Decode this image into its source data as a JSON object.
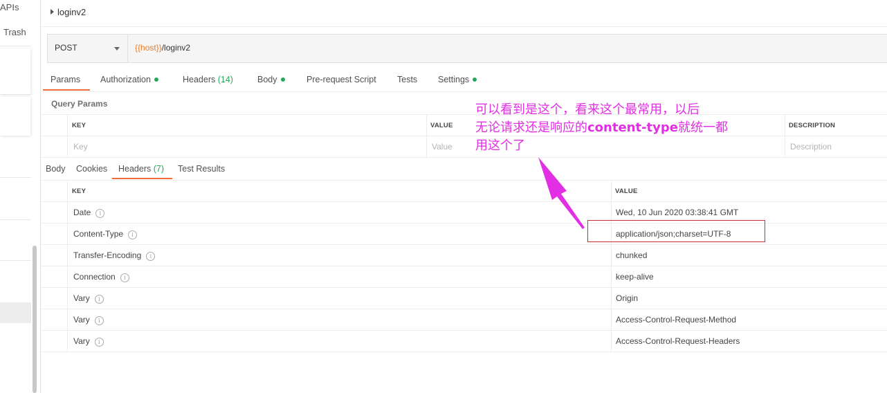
{
  "sidebar": {
    "tab_apis": "APIs",
    "tab_trash": "Trash"
  },
  "request": {
    "name": "loginv2",
    "method": "POST",
    "url_variable": "{{host}}",
    "url_path": "/loginv2"
  },
  "request_tabs": [
    {
      "label": "Params"
    },
    {
      "label": "Authorization"
    },
    {
      "label": "Headers",
      "count": "(14)"
    },
    {
      "label": "Body"
    },
    {
      "label": "Pre-request Script"
    },
    {
      "label": "Tests"
    },
    {
      "label": "Settings"
    }
  ],
  "query_params": {
    "title": "Query Params",
    "col_key": "KEY",
    "col_value": "VALUE",
    "col_description": "DESCRIPTION",
    "key_placeholder": "Key",
    "value_placeholder": "Value",
    "description_placeholder": "Description"
  },
  "response_tabs": [
    {
      "label": "Body"
    },
    {
      "label": "Cookies"
    },
    {
      "label": "Headers",
      "count": "(7)"
    },
    {
      "label": "Test Results"
    }
  ],
  "response_headers": {
    "col_key": "KEY",
    "col_value": "VALUE",
    "rows": [
      {
        "key": "Date",
        "value": "Wed, 10 Jun 2020 03:38:41 GMT"
      },
      {
        "key": "Content-Type",
        "value": "application/json;charset=UTF-8"
      },
      {
        "key": "Transfer-Encoding",
        "value": "chunked"
      },
      {
        "key": "Connection",
        "value": "keep-alive"
      },
      {
        "key": "Vary",
        "value": "Origin"
      },
      {
        "key": "Vary",
        "value": "Access-Control-Request-Method"
      },
      {
        "key": "Vary",
        "value": "Access-Control-Request-Headers"
      }
    ]
  },
  "annotation": {
    "line1": "可以看到是这个，看来这个最常用，以后",
    "line2a": "无论请求还是响应的",
    "line2b": "content-type",
    "line2c": "就统一都",
    "line3": "用这个了"
  },
  "colors": {
    "accent_tab": "#f26b3a",
    "green": "#26a65b",
    "variable": "#e97c27",
    "annotation": "#e22fe4",
    "highlight_box": "#c9302c"
  }
}
